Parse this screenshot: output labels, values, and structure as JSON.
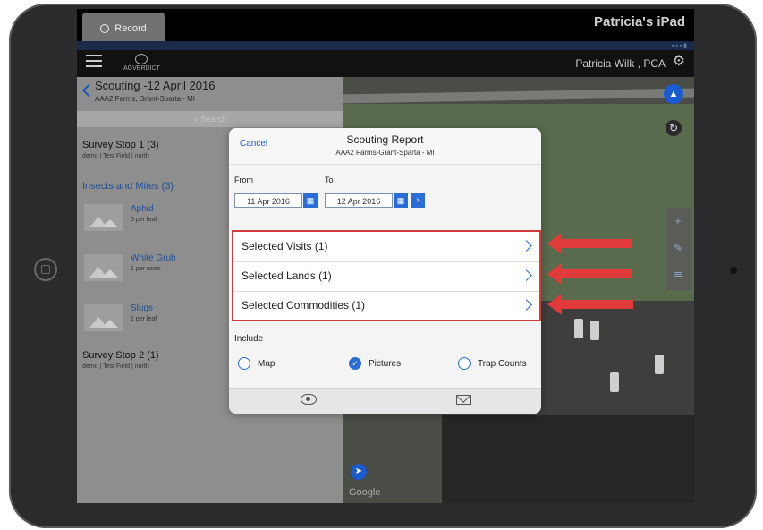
{
  "screen": {
    "record_label": "Record",
    "device_name": "Patricia's iPad"
  },
  "appbar": {
    "logo_text": "AGVERDICT",
    "user_name": "Patricia Wilk , PCA"
  },
  "left_pane": {
    "title": "Scouting -12 April 2016",
    "subtitle": "AAA2 Farms, Grant-Sparta - MI",
    "search_placeholder": "Search",
    "stops": [
      {
        "name": "Survey Stop 1 (3)",
        "detail": "demo | Test Field | north"
      },
      {
        "name": "Survey Stop 2 (1)",
        "detail": "demo | Test Field | north"
      }
    ],
    "category": "Insects and Mites (3)",
    "items": [
      {
        "name": "Aphid",
        "detail": "0 per leaf"
      },
      {
        "name": "White Grub",
        "detail": "1 per roots"
      },
      {
        "name": "Slugs",
        "detail": "1 per leaf"
      }
    ]
  },
  "map": {
    "google_label": "Google"
  },
  "modal": {
    "cancel_label": "Cancel",
    "title": "Scouting Report",
    "subtitle": "AAA2 Farms-Grant-Sparta - MI",
    "from_label": "From",
    "to_label": "To",
    "from_date": "11 Apr 2016",
    "to_date": "12 Apr 2016",
    "selections": [
      {
        "label": "Selected Visits (1)"
      },
      {
        "label": "Selected Lands (1)"
      },
      {
        "label": "Selected Commodities (1)"
      }
    ],
    "include_label": "Include",
    "options": [
      {
        "label": "Map",
        "checked": false
      },
      {
        "label": "Pictures",
        "checked": true
      },
      {
        "label": "Trap Counts",
        "checked": false
      }
    ]
  },
  "colors": {
    "accent": "#2a6dd6",
    "highlight": "#e23a3a"
  }
}
